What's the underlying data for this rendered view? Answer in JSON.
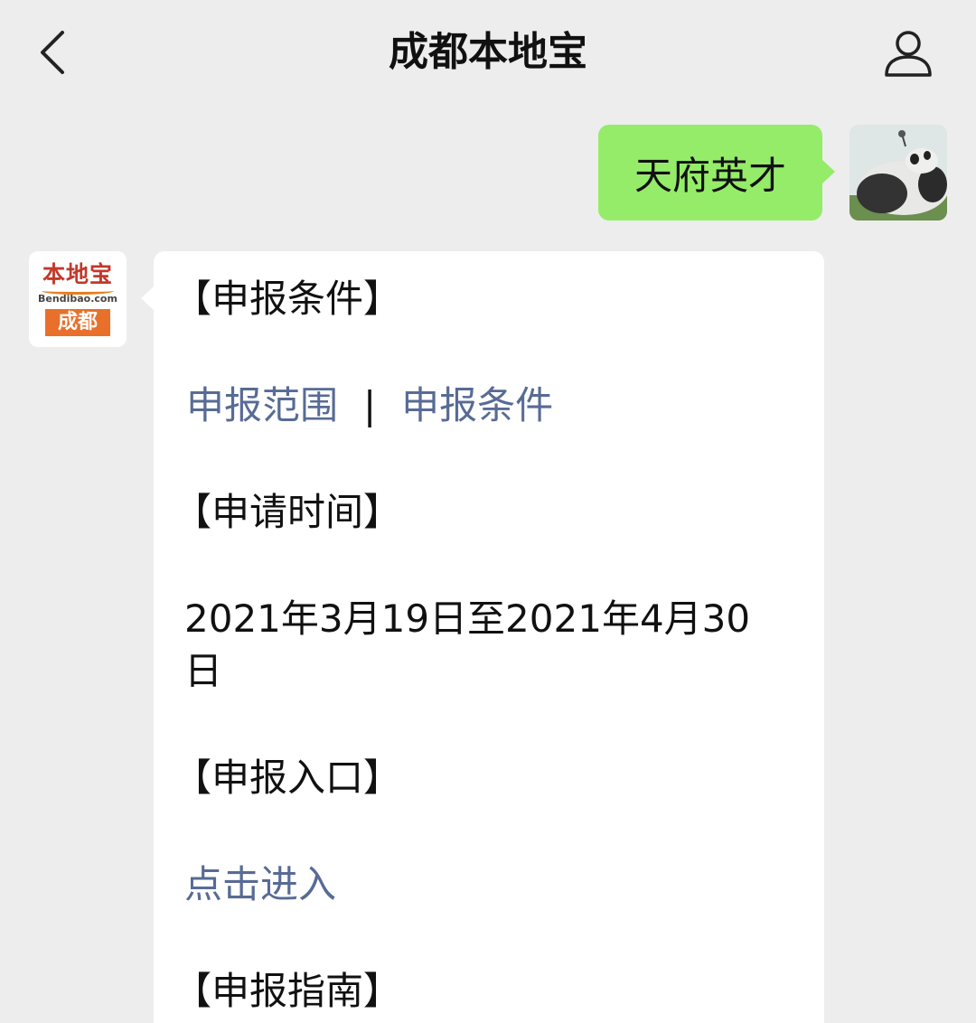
{
  "header": {
    "title": "成都本地宝"
  },
  "messages": {
    "outgoing_text": "天府英才",
    "bot_logo": {
      "top": "本地宝",
      "mid": "Bendibao.com",
      "bottom": "成都"
    },
    "heading_conditions": "【申报条件】",
    "link_scope": "申报范围",
    "separator": "|",
    "link_conditions": "申报条件",
    "heading_time": "【申请时间】",
    "time_line1": "2021年3月19日至2021年4月30",
    "time_line2": "日",
    "heading_entry": "【申报入口】",
    "link_enter": "点击进入",
    "heading_guide": "【申报指南】"
  },
  "colors": {
    "background": "#ededed",
    "outgoing_bubble": "#95ec69",
    "link": "#576b95"
  }
}
